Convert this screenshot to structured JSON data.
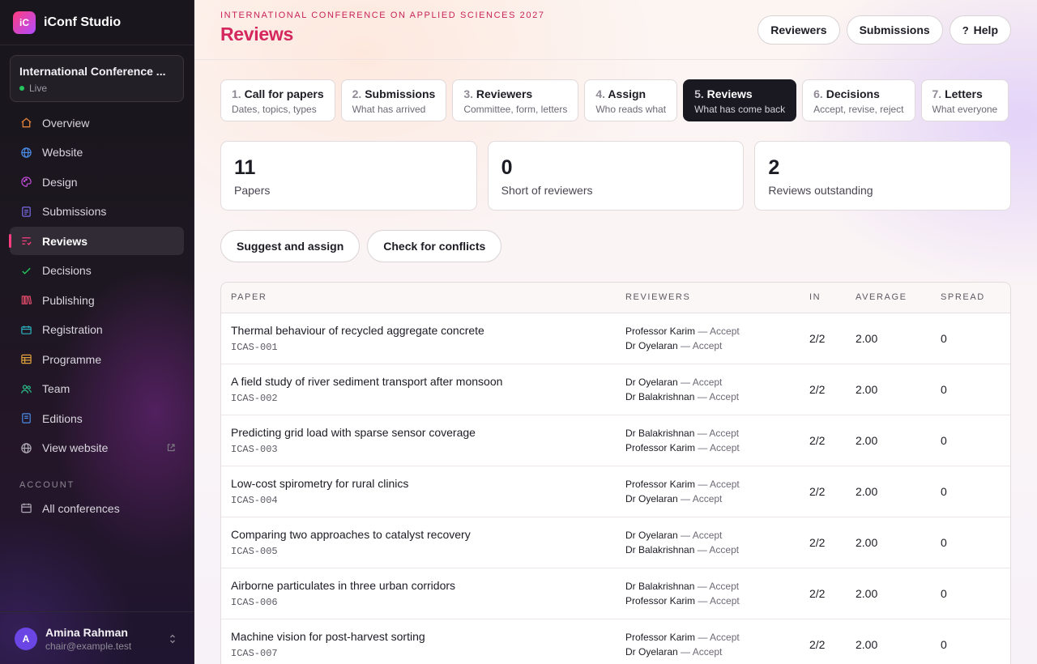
{
  "brand": {
    "logo": "iC",
    "name": "iConf Studio"
  },
  "conference": {
    "name": "International Conference ...",
    "status": "Live"
  },
  "sidebar": {
    "items": [
      {
        "label": "Overview",
        "icon": "home-icon",
        "color": "#e0803a"
      },
      {
        "label": "Website",
        "icon": "globe-icon",
        "color": "#4a8be6"
      },
      {
        "label": "Design",
        "icon": "palette-icon",
        "color": "#c04bd6"
      },
      {
        "label": "Submissions",
        "icon": "document-icon",
        "color": "#7a6be6"
      },
      {
        "label": "Reviews",
        "icon": "review-icon",
        "color": "#ff3d7f"
      },
      {
        "label": "Decisions",
        "icon": "check-icon",
        "color": "#22c55e"
      },
      {
        "label": "Publishing",
        "icon": "books-icon",
        "color": "#e04a6a"
      },
      {
        "label": "Registration",
        "icon": "ticket-icon",
        "color": "#2bb3c0"
      },
      {
        "label": "Programme",
        "icon": "calendar-grid-icon",
        "color": "#e0a23a"
      },
      {
        "label": "Team",
        "icon": "team-icon",
        "color": "#2bbf8a"
      },
      {
        "label": "Editions",
        "icon": "editions-icon",
        "color": "#4a8be6"
      },
      {
        "label": "View website",
        "icon": "globe-outline-icon",
        "color": "#b0abb6"
      }
    ],
    "account_label": "ACCOUNT",
    "account_items": [
      {
        "label": "All conferences",
        "icon": "calendar-icon",
        "color": "#b0abb6"
      }
    ]
  },
  "user": {
    "initial": "A",
    "name": "Amina Rahman",
    "email": "chair@example.test"
  },
  "header": {
    "eyebrow": "INTERNATIONAL CONFERENCE ON APPLIED SCIENCES 2027",
    "title": "Reviews",
    "buttons": {
      "reviewers": "Reviewers",
      "submissions": "Submissions",
      "help_icon": "?",
      "help": "Help"
    }
  },
  "steps": [
    {
      "num": "1.",
      "title": "Call for papers",
      "sub": "Dates, topics, types"
    },
    {
      "num": "2.",
      "title": "Submissions",
      "sub": "What has arrived"
    },
    {
      "num": "3.",
      "title": "Reviewers",
      "sub": "Committee, form, letters"
    },
    {
      "num": "4.",
      "title": "Assign",
      "sub": "Who reads what"
    },
    {
      "num": "5.",
      "title": "Reviews",
      "sub": "What has come back"
    },
    {
      "num": "6.",
      "title": "Decisions",
      "sub": "Accept, revise, reject"
    },
    {
      "num": "7.",
      "title": "Letters",
      "sub": "What everyone"
    }
  ],
  "stats": [
    {
      "value": "11",
      "label": "Papers"
    },
    {
      "value": "0",
      "label": "Short of reviewers"
    },
    {
      "value": "2",
      "label": "Reviews outstanding"
    }
  ],
  "actions": {
    "suggest": "Suggest and assign",
    "conflicts": "Check for conflicts"
  },
  "table": {
    "headers": {
      "paper": "PAPER",
      "reviewers": "REVIEWERS",
      "in": "IN",
      "average": "AVERAGE",
      "spread": "SPREAD"
    },
    "rows": [
      {
        "title": "Thermal behaviour of recycled aggregate concrete",
        "id": "ICAS-001",
        "reviewers": [
          {
            "name": "Professor Karim",
            "verdict": "— Accept"
          },
          {
            "name": "Dr Oyelaran",
            "verdict": "— Accept"
          }
        ],
        "in": "2/2",
        "average": "2.00",
        "spread": "0"
      },
      {
        "title": "A field study of river sediment transport after monsoon",
        "id": "ICAS-002",
        "reviewers": [
          {
            "name": "Dr Oyelaran",
            "verdict": "— Accept"
          },
          {
            "name": "Dr Balakrishnan",
            "verdict": "— Accept"
          }
        ],
        "in": "2/2",
        "average": "2.00",
        "spread": "0"
      },
      {
        "title": "Predicting grid load with sparse sensor coverage",
        "id": "ICAS-003",
        "reviewers": [
          {
            "name": "Dr Balakrishnan",
            "verdict": "— Accept"
          },
          {
            "name": "Professor Karim",
            "verdict": "— Accept"
          }
        ],
        "in": "2/2",
        "average": "2.00",
        "spread": "0"
      },
      {
        "title": "Low-cost spirometry for rural clinics",
        "id": "ICAS-004",
        "reviewers": [
          {
            "name": "Professor Karim",
            "verdict": "— Accept"
          },
          {
            "name": "Dr Oyelaran",
            "verdict": "— Accept"
          }
        ],
        "in": "2/2",
        "average": "2.00",
        "spread": "0"
      },
      {
        "title": "Comparing two approaches to catalyst recovery",
        "id": "ICAS-005",
        "reviewers": [
          {
            "name": "Dr Oyelaran",
            "verdict": "— Accept"
          },
          {
            "name": "Dr Balakrishnan",
            "verdict": "— Accept"
          }
        ],
        "in": "2/2",
        "average": "2.00",
        "spread": "0"
      },
      {
        "title": "Airborne particulates in three urban corridors",
        "id": "ICAS-006",
        "reviewers": [
          {
            "name": "Dr Balakrishnan",
            "verdict": "— Accept"
          },
          {
            "name": "Professor Karim",
            "verdict": "— Accept"
          }
        ],
        "in": "2/2",
        "average": "2.00",
        "spread": "0"
      },
      {
        "title": "Machine vision for post-harvest sorting",
        "id": "ICAS-007",
        "reviewers": [
          {
            "name": "Professor Karim",
            "verdict": "— Accept"
          },
          {
            "name": "Dr Oyelaran",
            "verdict": "— Accept"
          }
        ],
        "in": "2/2",
        "average": "2.00",
        "spread": "0"
      }
    ]
  }
}
